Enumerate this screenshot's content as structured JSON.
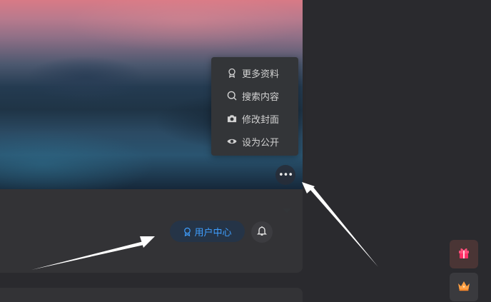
{
  "menu": {
    "items": [
      {
        "label": "更多资料",
        "icon": "badge-icon"
      },
      {
        "label": "搜索内容",
        "icon": "search-icon"
      },
      {
        "label": "修改封面",
        "icon": "camera-icon"
      },
      {
        "label": "设为公开",
        "icon": "eye-icon"
      }
    ]
  },
  "more_button": {
    "label": "•••",
    "icon": "more-icon"
  },
  "profile": {
    "user_center_label": "用户中心",
    "user_center_color": "#3f9fff",
    "bell_icon": "bell-icon"
  },
  "sidebar": {
    "gift_icon": "gift-icon",
    "crown_icon": "crown-icon"
  }
}
